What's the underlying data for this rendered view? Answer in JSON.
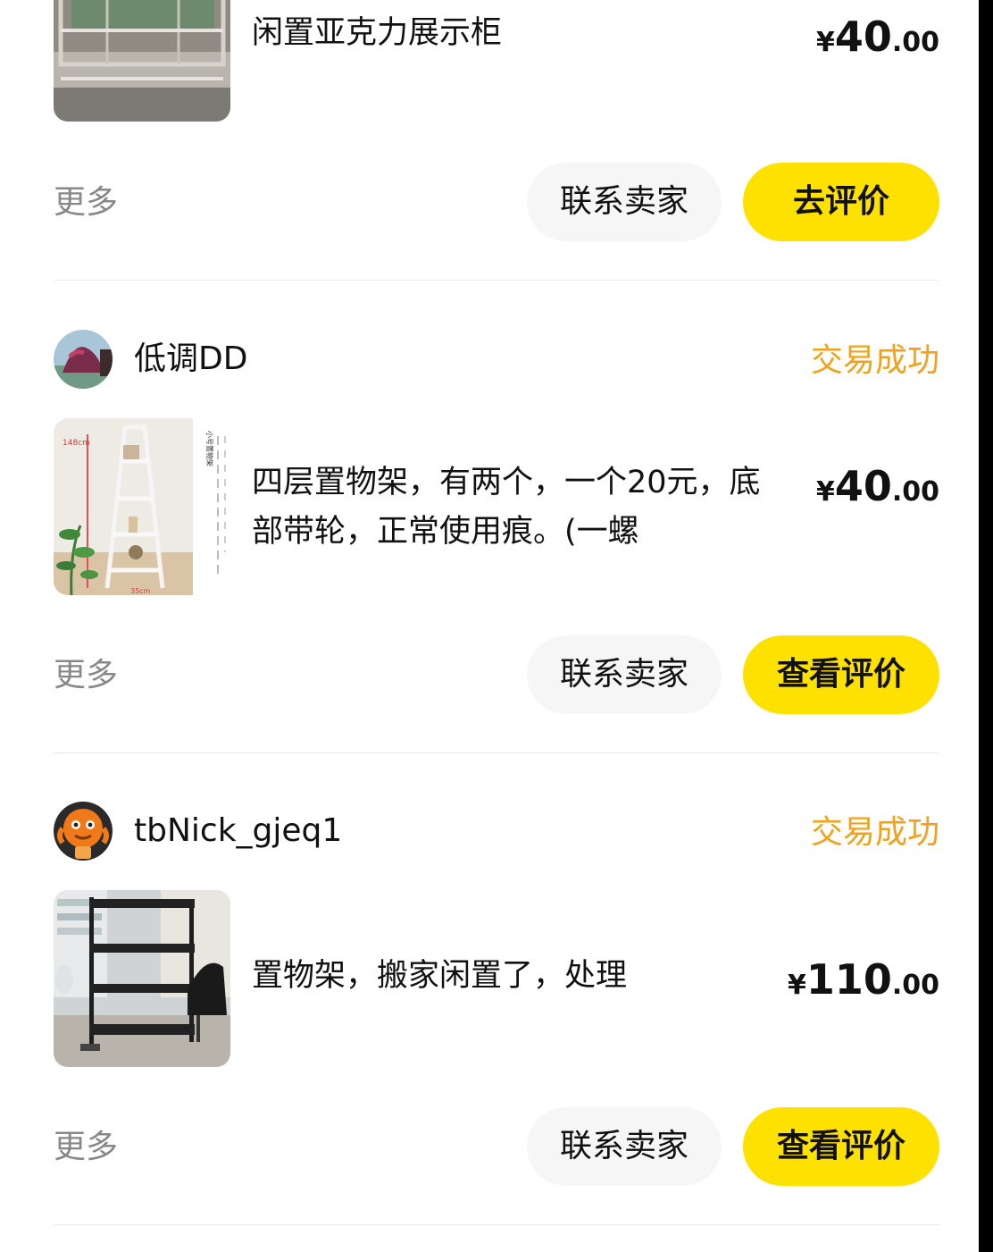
{
  "orders": [
    {
      "title": "闲置亚克力展示柜",
      "price": {
        "currency": "¥",
        "integer": "40",
        "decimal": ".00"
      },
      "more_label": "更多",
      "contact_label": "联系卖家",
      "review_label": "去评价"
    },
    {
      "seller": "低调DD",
      "status": "交易成功",
      "title": "四层置物架，有两个，一个20元，底部带轮，正常使用痕。(一螺",
      "price": {
        "currency": "¥",
        "integer": "40",
        "decimal": ".00"
      },
      "thumb_text": {
        "height": "148cm",
        "width": "35cm",
        "heading": "小号置物架"
      },
      "more_label": "更多",
      "contact_label": "联系卖家",
      "review_label": "查看评价"
    },
    {
      "seller": "tbNick_gjeq1",
      "status": "交易成功",
      "title": "置物架，搬家闲置了，处理",
      "price": {
        "currency": "¥",
        "integer": "110",
        "decimal": ".00"
      },
      "more_label": "更多",
      "contact_label": "联系卖家",
      "review_label": "查看评价"
    }
  ],
  "colors": {
    "accent_yellow": "#ffe100",
    "status_orange": "#f0a21a",
    "muted_gray": "#888888",
    "button_gray": "#f6f6f6"
  }
}
